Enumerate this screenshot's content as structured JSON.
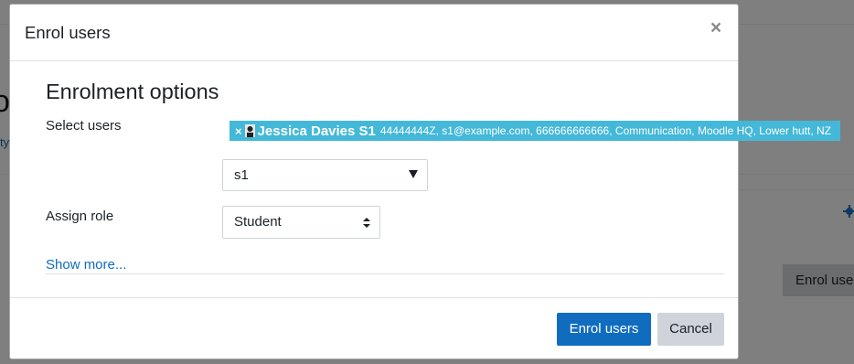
{
  "background": {
    "fragment_text_left": "ty",
    "button_label": "Enrol user",
    "gear_icon": "gear-icon"
  },
  "modal": {
    "title": "Enrol users",
    "close_glyph": "×",
    "section_title": "Enrolment options",
    "select_users_label": "Select users",
    "selected_user": {
      "remove_glyph": "×",
      "name": "Jessica Davies S1",
      "details": "44444444Z, s1@example.com, 666666666666, Communication, Moodle HQ, Lower hutt, NZ"
    },
    "search_value": "s1",
    "assign_role_label": "Assign role",
    "role_value": "Student",
    "show_more": "Show more...",
    "buttons": {
      "enrol": "Enrol users",
      "cancel": "Cancel"
    }
  },
  "colors": {
    "primary": "#0f6cbf",
    "chip": "#44b8d8",
    "secondary_button": "#ced4da"
  }
}
